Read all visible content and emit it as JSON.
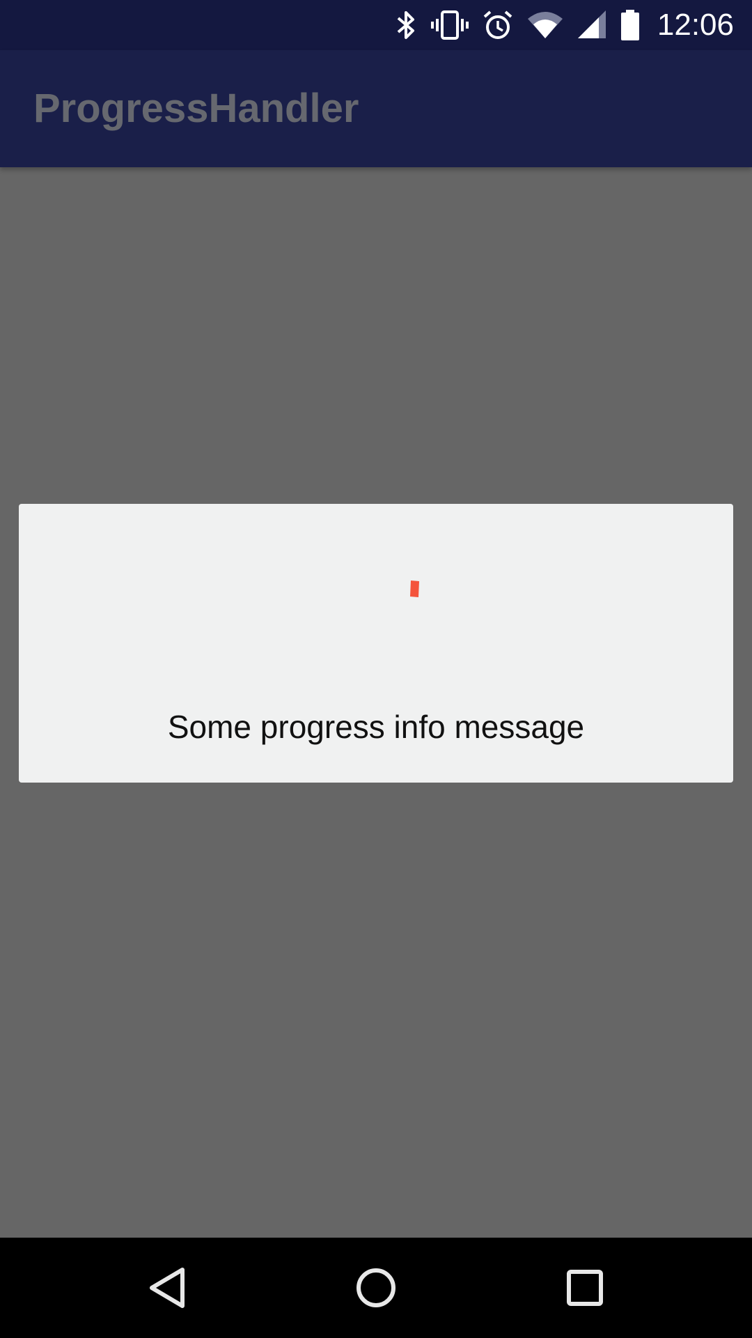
{
  "status_bar": {
    "time": "12:06",
    "background_color": "#141840",
    "icons": [
      "bluetooth-icon",
      "vibrate-icon",
      "alarm-icon",
      "wifi-icon",
      "cell-signal-icon",
      "battery-icon"
    ]
  },
  "app_bar": {
    "title": "ProgressHandler",
    "background_color": "#1a1f49"
  },
  "dialog": {
    "message": "Some progress info message",
    "spinner_color": "#f4543c",
    "background_color": "#f0f1f1"
  },
  "scrim_color": "#666666",
  "nav_bar": {
    "buttons": [
      "back-icon",
      "home-icon",
      "recents-icon"
    ]
  }
}
